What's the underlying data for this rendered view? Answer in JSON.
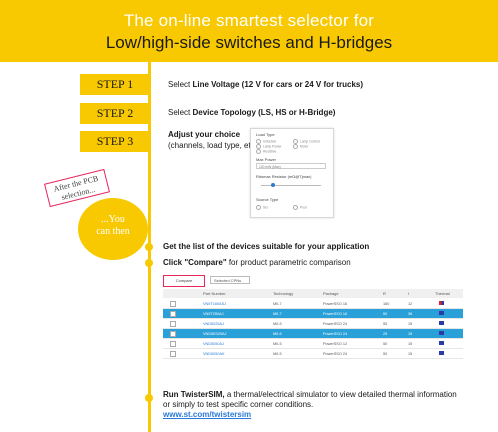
{
  "banner": {
    "line1": "The on-line smartest selector for",
    "line2": "Low/high-side switches and H-bridges"
  },
  "steps": [
    {
      "label": "STEP 1",
      "text_pre": "Select ",
      "text_bold": "Line Voltage (12 V for cars or 24 V for trucks)",
      "text_post": ""
    },
    {
      "label": "STEP 2",
      "text_pre": "Select ",
      "text_bold": "Device Topology (LS, HS or H-Bridge)",
      "text_post": ""
    },
    {
      "label": "STEP 3",
      "text_bold": "Adjust your choice",
      "text_post": "(channels, load type, etc.)"
    }
  ],
  "panel": {
    "load_type": "Load Type",
    "options": [
      "Inductive",
      "Lamp Control",
      "Lamp Power",
      "Motor",
      "Resistive"
    ],
    "max_power": "Max Power",
    "max_power_value": "120 mW (Max)",
    "resistance": "Rdsmax Resistor (mΩ@Tjmax)",
    "source_type": "Source Type",
    "source_options": [
      "SG",
      "Pout"
    ]
  },
  "after_note": "After the PCB selection...",
  "circle_text": [
    "...You",
    "can then"
  ],
  "bullet1": "Get the list of the devices suitable for your application",
  "bullet2_bold": "Click \"Compare\"",
  "bullet2_rest": " for product parametric comparison",
  "table": {
    "compare_btn": "Compare",
    "select_label": "Selected CPNs",
    "headers": [
      "Part Number",
      "Technology",
      "Package",
      "R",
      "I",
      "Thermal"
    ],
    "rows": [
      {
        "pn": "VN5T160ASJ",
        "tech": "M0-7",
        "pkg": "PowerSSO 16",
        "r": "160",
        "i": "12",
        "hl": false,
        "red": true
      },
      {
        "pn": "VN5T250AJ",
        "tech": "M0-7",
        "pkg": "PowerSSO 16",
        "r": "50",
        "i": "36",
        "hl": true,
        "red": false
      },
      {
        "pn": "VND5025AJ",
        "tech": "M0-5",
        "pkg": "PowerSSO 24",
        "r": "50",
        "i": "15",
        "hl": false,
        "red": false
      },
      {
        "pn": "VND5E025AJ",
        "tech": "M0-5",
        "pkg": "PowerSSO 24",
        "r": "25",
        "i": "15",
        "hl": true,
        "red": false
      },
      {
        "pn": "VND5050AJ",
        "tech": "M0-5",
        "pkg": "PowerSSO 12",
        "r": "50",
        "i": "15",
        "hl": false,
        "red": false
      },
      {
        "pn": "VND5050AK",
        "tech": "M0-5",
        "pkg": "PowerSSO 24",
        "r": "50",
        "i": "15",
        "hl": false,
        "red": false
      }
    ]
  },
  "twister_bold": "Run TwisterSIM,",
  "twister_rest": " a thermal/electrical simulator to view detailed thermal information or simply to test specific corner conditions.",
  "twister_link": "www.st.com/twistersim",
  "colors": {
    "accent": "#f8c800",
    "highlight": "#2aa0d8",
    "pink": "#e8265c"
  }
}
